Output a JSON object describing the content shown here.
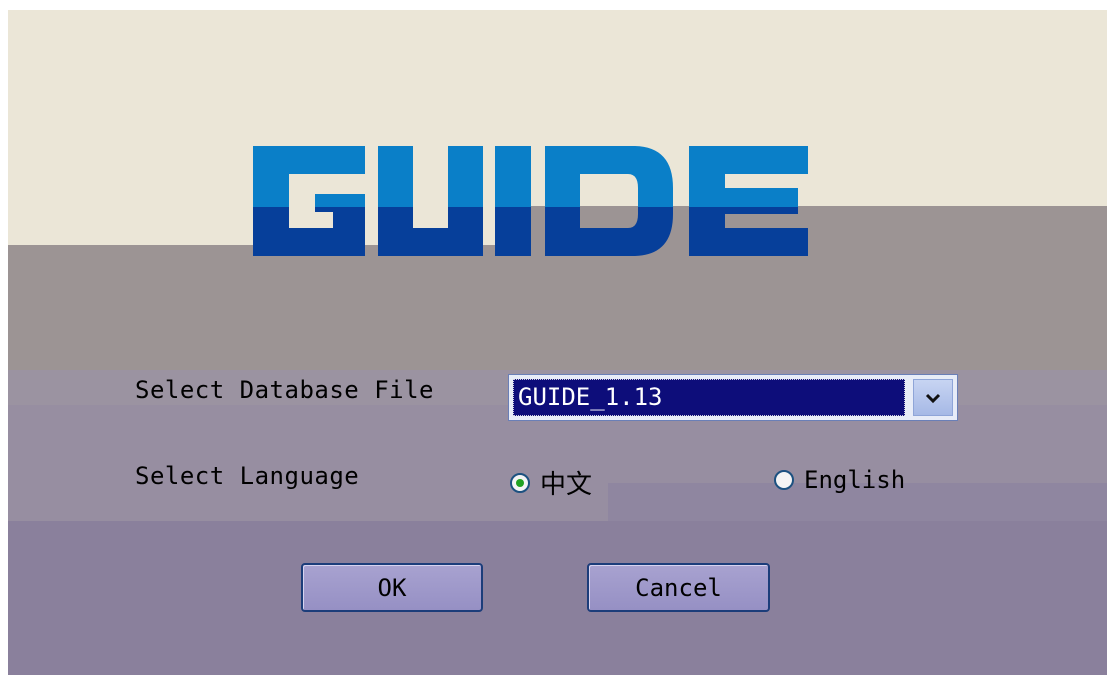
{
  "logo": {
    "text": "GUIDE",
    "colors": {
      "light": "#0a7fc8",
      "dark": "#063f9a"
    }
  },
  "form": {
    "database_label": "Select Database File",
    "database_value": "GUIDE_1.13",
    "language_label": "Select Language",
    "languages": [
      {
        "label": "中文",
        "selected": true
      },
      {
        "label": "English",
        "selected": false
      }
    ]
  },
  "buttons": {
    "ok": "OK",
    "cancel": "Cancel"
  },
  "icons": {
    "dropdown": "chevron-down-icon",
    "radio_selected": "radio-selected-icon",
    "radio_unselected": "radio-unselected-icon"
  },
  "colors": {
    "top_background": "#ebe6d7",
    "mid_background": "#9c9494",
    "bottom_background": "#8a809c",
    "select_highlight": "#0d0d7a",
    "button_fill": "#9d97c9",
    "button_border": "#1c3d7a"
  }
}
